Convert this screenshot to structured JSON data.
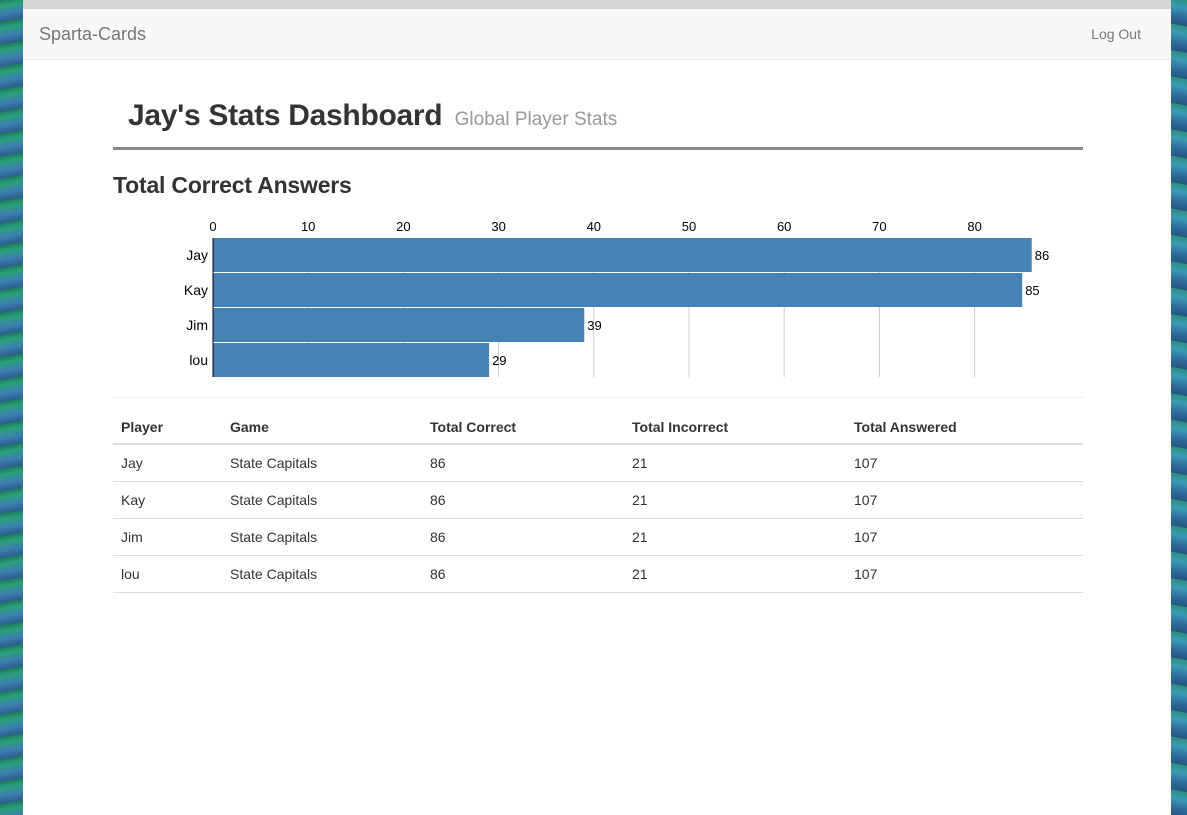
{
  "navbar": {
    "brand": "Sparta-Cards",
    "logout": "Log Out"
  },
  "header": {
    "title": "Jay's Stats Dashboard",
    "subtitle": "Global Player Stats"
  },
  "section_title": "Total Correct Answers",
  "colors": {
    "bar": "#4682b4",
    "grid": "#cccccc"
  },
  "chart_data": {
    "type": "bar",
    "orientation": "horizontal",
    "categories": [
      "Jay",
      "Kay",
      "Jim",
      "lou"
    ],
    "values": [
      86,
      85,
      39,
      29
    ],
    "xlim": [
      0,
      86
    ],
    "xticks": [
      0,
      10,
      20,
      30,
      40,
      50,
      60,
      70,
      80
    ],
    "axis_position": "top",
    "grid": true,
    "title": "",
    "xlabel": "",
    "ylabel": ""
  },
  "table": {
    "headers": [
      "Player",
      "Game",
      "Total Correct",
      "Total Incorrect",
      "Total Answered"
    ],
    "rows": [
      [
        "Jay",
        "State Capitals",
        "86",
        "21",
        "107"
      ],
      [
        "Kay",
        "State Capitals",
        "86",
        "21",
        "107"
      ],
      [
        "Jim",
        "State Capitals",
        "86",
        "21",
        "107"
      ],
      [
        "lou",
        "State Capitals",
        "86",
        "21",
        "107"
      ]
    ]
  }
}
